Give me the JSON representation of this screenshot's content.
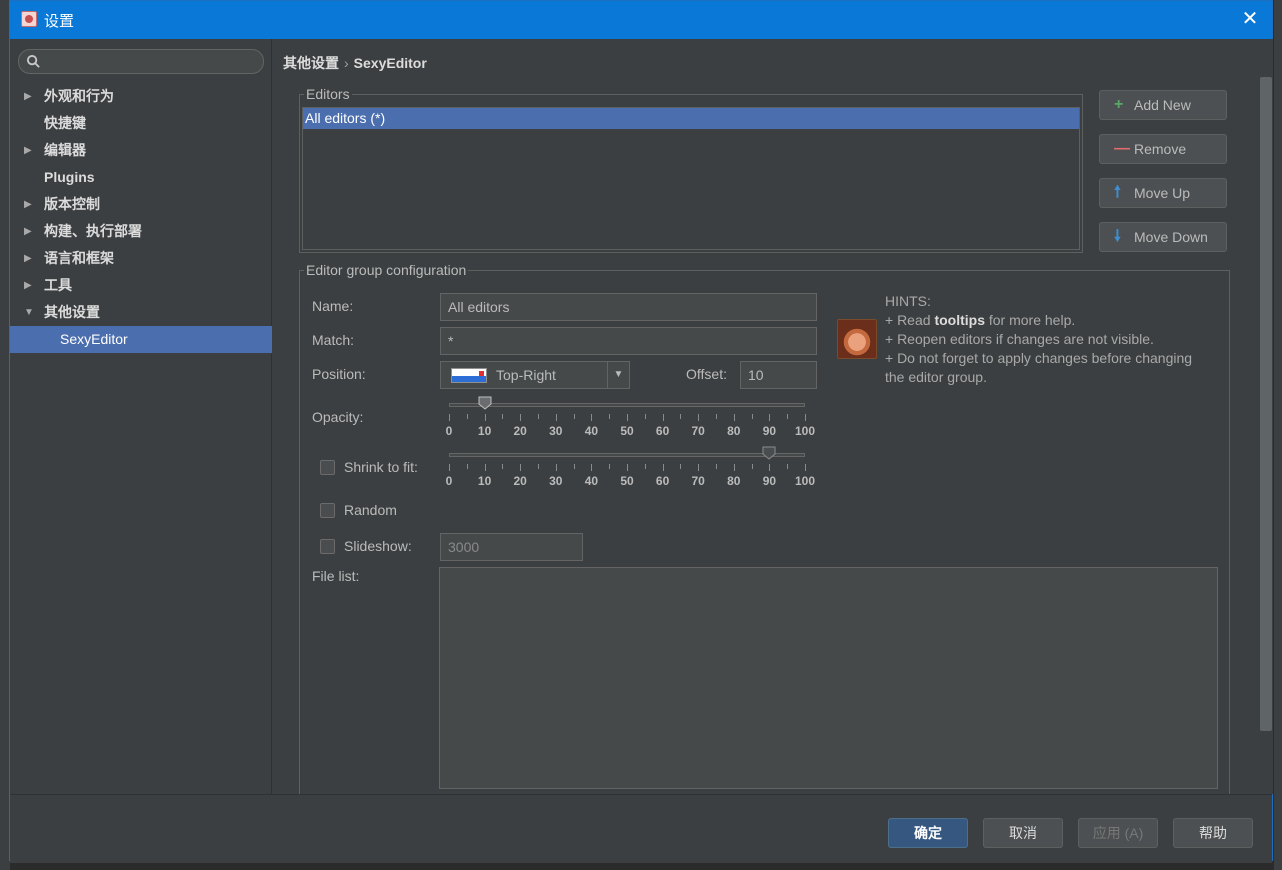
{
  "window": {
    "title": "设置",
    "close_glyph": "✕"
  },
  "search": {
    "placeholder": "",
    "icon": "search-icon"
  },
  "sidebar": {
    "items": [
      {
        "label": "外观和行为",
        "expandable": true,
        "expanded": false
      },
      {
        "label": "快捷键",
        "expandable": false
      },
      {
        "label": "编辑器",
        "expandable": true,
        "expanded": false
      },
      {
        "label": "Plugins",
        "expandable": false
      },
      {
        "label": "版本控制",
        "expandable": true,
        "expanded": false
      },
      {
        "label": "构建、执行部署",
        "expandable": true,
        "expanded": false
      },
      {
        "label": "语言和框架",
        "expandable": true,
        "expanded": false
      },
      {
        "label": "工具",
        "expandable": true,
        "expanded": false
      },
      {
        "label": "其他设置",
        "expandable": true,
        "expanded": true
      },
      {
        "label": "SexyEditor",
        "sub": true,
        "selected": true
      }
    ]
  },
  "breadcrumb": {
    "parent": "其他设置",
    "separator": "›",
    "current": "SexyEditor"
  },
  "editors": {
    "group_title": "Editors",
    "items": [
      "All editors (*)"
    ],
    "selected_index": 0,
    "buttons": {
      "add": {
        "icon": "+",
        "label": "Add New",
        "color": "#59a869"
      },
      "remove": {
        "icon": "—",
        "label": "Remove",
        "color": "#e06c6c"
      },
      "move_up": {
        "icon": "🠕",
        "label": "Move Up",
        "color": "#3d8fd1"
      },
      "move_down": {
        "icon": "🠗",
        "label": "Move Down",
        "color": "#3d8fd1"
      }
    }
  },
  "config": {
    "group_title": "Editor group configuration",
    "name": {
      "label": "Name:",
      "value": "All editors"
    },
    "match": {
      "label": "Match:",
      "value": "*"
    },
    "position": {
      "label": "Position:",
      "value": "Top-Right",
      "dropdown_glyph": "▼"
    },
    "offset": {
      "label": "Offset:",
      "value": "10"
    },
    "opacity": {
      "label": "Opacity:",
      "value": 10,
      "min": 0,
      "max": 100
    },
    "shrink": {
      "label": "Shrink to fit:",
      "checked": false,
      "value": 90,
      "min": 0,
      "max": 100
    },
    "tick_labels": [
      "0",
      "10",
      "20",
      "30",
      "40",
      "50",
      "60",
      "70",
      "80",
      "90",
      "100"
    ],
    "random": {
      "label": "Random",
      "checked": false
    },
    "slideshow": {
      "label": "Slideshow:",
      "checked": false,
      "value": "3000"
    },
    "file_list": {
      "label": "File list:"
    }
  },
  "hints": {
    "heading": "HINTS:",
    "line1_prefix": "+ Read ",
    "line1_bold": "tooltips",
    "line1_suffix": " for more help.",
    "line2": "+ Reopen editors if changes are not visible.",
    "line3": "+ Do not forget to apply changes before changing the editor group."
  },
  "footer": {
    "ok": "确定",
    "cancel": "取消",
    "apply": "应用 (A)",
    "help": "帮助"
  },
  "colors": {
    "accent": "#4b6eaf",
    "titlebar": "#0a78d7",
    "background": "#3c3f41"
  }
}
